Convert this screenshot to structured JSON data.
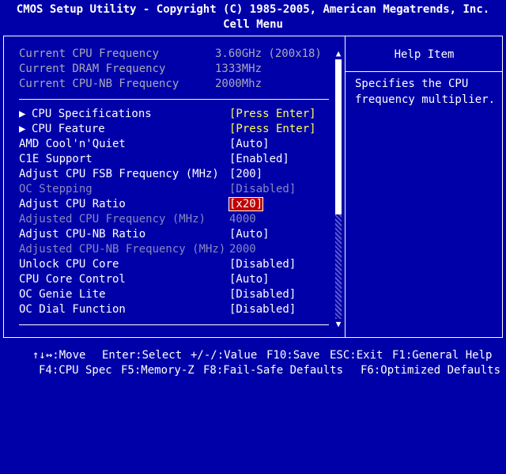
{
  "header": {
    "title": "CMOS Setup Utility - Copyright (C) 1985-2005, American Megatrends, Inc.",
    "menu": "Cell Menu"
  },
  "info": [
    {
      "label": "Current CPU Frequency",
      "value": "3.60GHz (200x18)"
    },
    {
      "label": "Current DRAM Frequency",
      "value": "1333MHz"
    },
    {
      "label": "Current CPU-NB Frequency",
      "value": "2000Mhz"
    }
  ],
  "items": [
    {
      "label": "CPU Specifications",
      "value": "[Press Enter]",
      "submenu": true
    },
    {
      "label": "CPU Feature",
      "value": "[Press Enter]",
      "submenu": true
    },
    {
      "label": "AMD Cool'n'Quiet",
      "value": "[Auto]"
    },
    {
      "label": "C1E Support",
      "value": "[Enabled]"
    },
    {
      "label": "Adjust CPU FSB Frequency (MHz)",
      "value": "[200]"
    },
    {
      "label": "OC Stepping",
      "value": "[Disabled]",
      "disabled": true
    },
    {
      "label": "Adjust CPU Ratio",
      "value": "[x20]",
      "selected": true
    },
    {
      "label": "Adjusted CPU Frequency (MHz)",
      "value": "4000",
      "disabled": true
    },
    {
      "label": "Adjust CPU-NB Ratio",
      "value": "[Auto]"
    },
    {
      "label": "Adjusted CPU-NB Frequency (MHz)",
      "value": "2000",
      "disabled": true
    },
    {
      "label": "Unlock CPU Core",
      "value": "[Disabled]"
    },
    {
      "label": "CPU Core Control",
      "value": "[Auto]"
    },
    {
      "label": "OC Genie Lite",
      "value": "[Disabled]"
    },
    {
      "label": "OC Dial Function",
      "value": "[Disabled]"
    }
  ],
  "submenu_marker": "▶",
  "help": {
    "title": "Help Item",
    "text": "Specifies the CPU\nfrequency multiplier."
  },
  "scroll": {
    "up": "▲",
    "down": "▼"
  },
  "footer": {
    "line1": [
      "↑↓↔:Move",
      "Enter:Select",
      "+/-/:Value",
      "F10:Save",
      "ESC:Exit",
      "F1:General Help"
    ],
    "line2": [
      "F4:CPU Spec",
      "F5:Memory-Z",
      "F8:Fail-Safe Defaults",
      "F6:Optimized Defaults"
    ]
  }
}
